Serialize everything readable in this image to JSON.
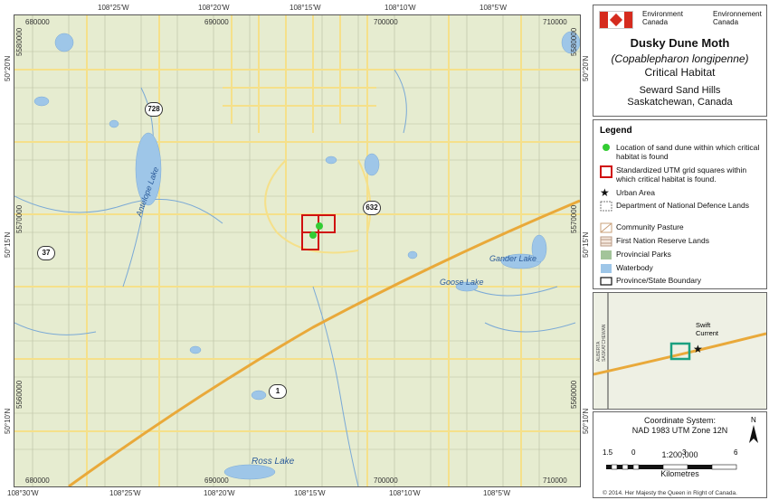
{
  "title": {
    "org_en": "Environment\nCanada",
    "org_fr": "Environnement\nCanada",
    "species": "Dusky Dune Moth",
    "latin": "(Copablepharon longipenne)",
    "subtitle": "Critical Habitat",
    "place1": "Seward Sand Hills",
    "place2": "Saskatchewan, Canada"
  },
  "grid": {
    "top_easting": [
      "680000",
      "690000",
      "700000",
      "710000"
    ],
    "bottom_easting": [
      "680000",
      "690000",
      "700000",
      "710000"
    ],
    "top_long": [
      "108°25'W",
      "108°20'W",
      "108°15'W",
      "108°10'W",
      "108°5'W"
    ],
    "bottom_long": [
      "108°30'W",
      "108°25'W",
      "108°20'W",
      "108°15'W",
      "108°10'W",
      "108°5'W"
    ],
    "left_northing": [
      "5580000",
      "5570000",
      "5560000"
    ],
    "right_northing": [
      "5580000",
      "5570000",
      "5560000"
    ],
    "left_lat": [
      "50°20'N",
      "50°15'N",
      "50°10'N"
    ],
    "right_lat": [
      "50°20'N",
      "50°15'N",
      "50°10'N"
    ]
  },
  "map": {
    "highways": [
      "728",
      "632",
      "37",
      "1"
    ],
    "lakes": [
      "Antelope Lake",
      "Gander Lake",
      "Goose Lake",
      "Ross Lake"
    ],
    "colors": {
      "land": "#e6ecd0",
      "water": "#9ec6e8",
      "road": "#f5e08a",
      "highway": "#e9a93a",
      "habitat": "#d01010",
      "dune": "#33cc33"
    }
  },
  "legend": {
    "title": "Legend",
    "items": [
      {
        "label": "Location of sand dune within which critical habitat is found",
        "icon": "green-dot"
      },
      {
        "label": "Standardized UTM grid squares within which critical habitat is found.",
        "icon": "red-square"
      },
      {
        "label": "Urban Area",
        "icon": "star"
      },
      {
        "label": "Department of National Defence Lands",
        "icon": "dnd-pattern"
      },
      {
        "label": "Community Pasture",
        "icon": "pasture-pattern"
      },
      {
        "label": "First Nation Reserve Lands",
        "icon": "reserve-pattern"
      },
      {
        "label": "Provincial Parks",
        "icon": "park-fill"
      },
      {
        "label": "Waterbody",
        "icon": "water-fill"
      },
      {
        "label": "Province/State Boundary",
        "icon": "boundary-box"
      }
    ]
  },
  "inset": {
    "city": "Swift\nCurrent",
    "province": "ALBERTA\nSASKATCHEWAN"
  },
  "scale": {
    "coord1": "Coordinate System:",
    "coord2": "NAD 1983 UTM Zone 12N",
    "ratio": "1:200,000",
    "ticks": [
      "1.5",
      "0",
      "3",
      "6"
    ],
    "unit": "Kilometres",
    "north": "N"
  },
  "copyright": "© 2014. Her Majesty the Queen in Right of Canada."
}
